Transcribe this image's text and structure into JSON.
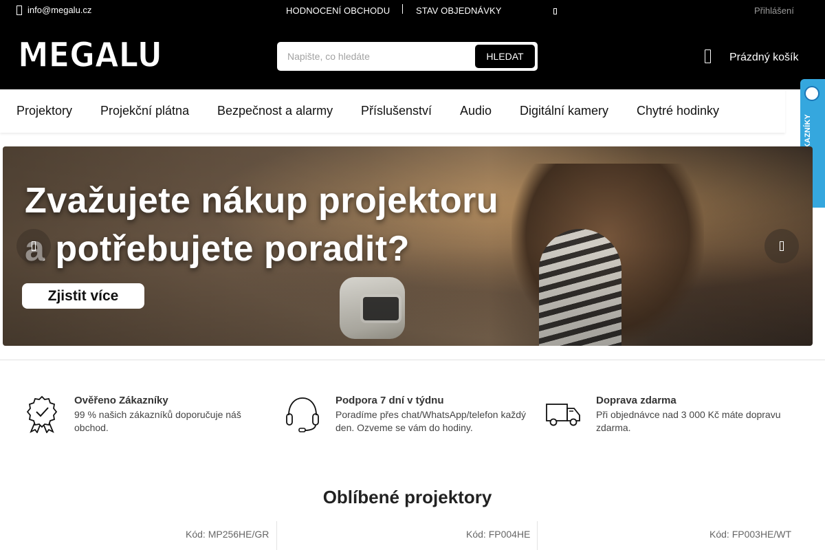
{
  "topbar": {
    "email": "info@megalu.cz",
    "links": [
      "HODNOCENÍ OBCHODU",
      "STAV OBJEDNÁVKY"
    ],
    "login": "Přihlášení"
  },
  "header": {
    "logo_text": "MEGALU",
    "search_placeholder": "Napište, co hledáte",
    "search_button": "HLEDAT",
    "cart_label": "Prázdný košík"
  },
  "nav": {
    "items": [
      "Projektory",
      "Projekční plátna",
      "Bezpečnost a alarmy",
      "Příslušenství",
      "Audio",
      "Digitální kamery",
      "Chytré hodinky"
    ]
  },
  "verified_tab": {
    "label": "OVĚŘENO ZÁKAZNÍKY",
    "accent": "#35a7de"
  },
  "banner": {
    "title_line1": "Zvažujete nákup projektoru",
    "title_line2": "a potřebujete poradit?",
    "cta": "Zjistit více"
  },
  "benefits": [
    {
      "icon": "award-ribbon-icon",
      "title": "Ověřeno Zákazníky",
      "text": "99 % našich zákazníků doporučuje náš obchod."
    },
    {
      "icon": "headset-icon",
      "title": "Podpora 7 dní v týdnu",
      "text": "Poradíme přes chat/WhatsApp/telefon každý den. Ozveme se vám do hodiny."
    },
    {
      "icon": "delivery-truck-icon",
      "title": "Doprava zdarma",
      "text": "Při objednávce nad 3 000 Kč máte dopravu zdarma."
    }
  ],
  "popular": {
    "title": "Oblíbené projektory",
    "products": [
      {
        "code": "Kód: MP256HE/GR"
      },
      {
        "code": "Kód: FP004HE"
      },
      {
        "code": "Kód: FP003HE/WT"
      }
    ]
  }
}
